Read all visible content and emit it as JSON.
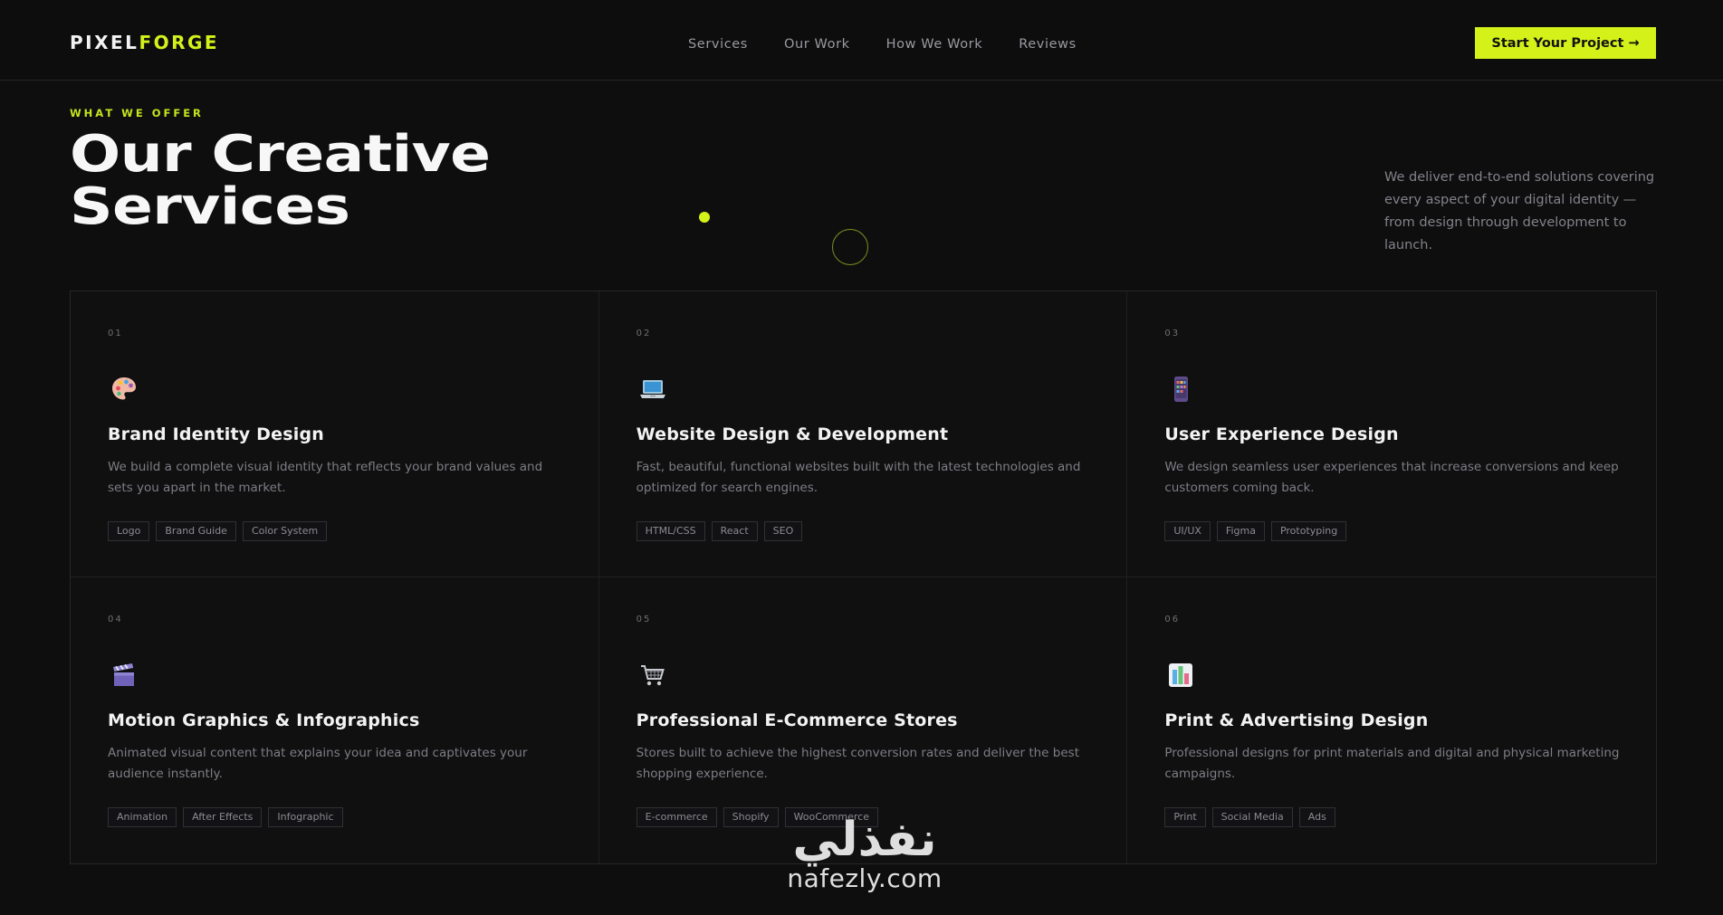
{
  "nav": {
    "logo_part1": "PIXEL",
    "logo_part2": "FORGE",
    "links": [
      "Services",
      "Our Work",
      "How We Work",
      "Reviews"
    ],
    "cta": "Start Your Project →"
  },
  "hero": {
    "eyebrow": "WHAT WE OFFER",
    "title_line1": "Our Creative",
    "title_line2": "Services",
    "description": "We deliver end-to-end solutions covering every aspect of your digital identity — from design through development to launch."
  },
  "colors": {
    "accent": "#d4f21a",
    "background": "#0e0e0f"
  },
  "services": [
    {
      "num": "01",
      "icon": "palette-icon",
      "title": "Brand Identity Design",
      "desc": "We build a complete visual identity that reflects your brand values and sets you apart in the market.",
      "tags": [
        "Logo",
        "Brand Guide",
        "Color System"
      ]
    },
    {
      "num": "02",
      "icon": "laptop-icon",
      "title": "Website Design & Development",
      "desc": "Fast, beautiful, functional websites built with the latest technologies and optimized for search engines.",
      "tags": [
        "HTML/CSS",
        "React",
        "SEO"
      ]
    },
    {
      "num": "03",
      "icon": "mobile-phone-icon",
      "title": "User Experience Design",
      "desc": "We design seamless user experiences that increase conversions and keep customers coming back.",
      "tags": [
        "UI/UX",
        "Figma",
        "Prototyping"
      ]
    },
    {
      "num": "04",
      "icon": "clapperboard-icon",
      "title": "Motion Graphics & Infographics",
      "desc": "Animated visual content that explains your idea and captivates your audience instantly.",
      "tags": [
        "Animation",
        "After Effects",
        "Infographic"
      ]
    },
    {
      "num": "05",
      "icon": "shopping-cart-icon",
      "title": "Professional E-Commerce Stores",
      "desc": "Stores built to achieve the highest conversion rates and deliver the best shopping experience.",
      "tags": [
        "E-commerce",
        "Shopify",
        "WooCommerce"
      ]
    },
    {
      "num": "06",
      "icon": "bar-chart-icon",
      "title": "Print & Advertising Design",
      "desc": "Professional designs for print materials and digital and physical marketing campaigns.",
      "tags": [
        "Print",
        "Social Media",
        "Ads"
      ]
    }
  ],
  "watermark": {
    "arabic": "نفذلي",
    "latin": "nafezly.com"
  }
}
